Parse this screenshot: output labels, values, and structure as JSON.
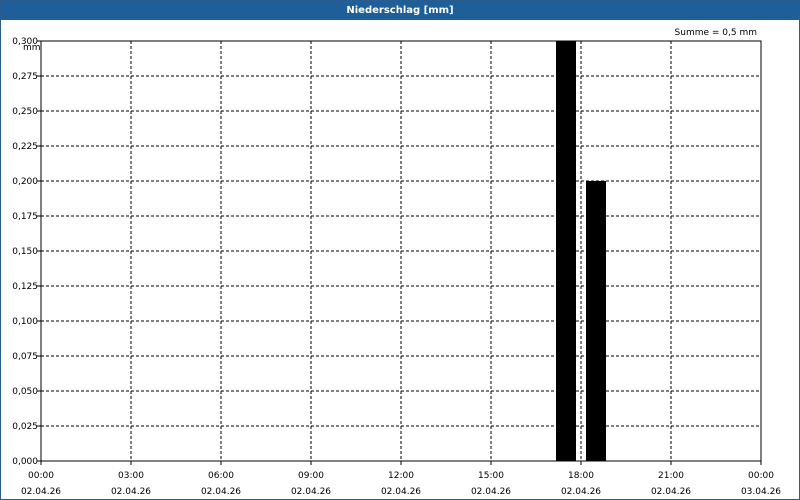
{
  "window": {
    "title": "Niederschlag [mm]"
  },
  "chart_data": {
    "type": "bar",
    "title": "Niederschlag [mm]",
    "ylabel": "mm",
    "summary": "Summe = 0,5 mm",
    "ylim": [
      0,
      0.3
    ],
    "yticks": [
      "0,000",
      "0,025",
      "0,050",
      "0,075",
      "0,100",
      "0,125",
      "0,150",
      "0,175",
      "0,200",
      "0,225",
      "0,250",
      "0,275",
      "0,300"
    ],
    "xlim_hours": [
      0,
      24
    ],
    "xticks": [
      {
        "time": "00:00",
        "date": "02.04.26"
      },
      {
        "time": "03:00",
        "date": "02.04.26"
      },
      {
        "time": "06:00",
        "date": "02.04.26"
      },
      {
        "time": "09:00",
        "date": "02.04.26"
      },
      {
        "time": "12:00",
        "date": "02.04.26"
      },
      {
        "time": "15:00",
        "date": "02.04.26"
      },
      {
        "time": "18:00",
        "date": "02.04.26"
      },
      {
        "time": "21:00",
        "date": "02.04.26"
      },
      {
        "time": "00:00",
        "date": "03.04.26"
      }
    ],
    "bars": [
      {
        "start": "02.04.26 17:10",
        "end": "02.04.26 17:50",
        "value": 0.3
      },
      {
        "start": "02.04.26 18:10",
        "end": "02.04.26 18:50",
        "value": 0.2
      }
    ],
    "grid": true,
    "bar_color": "#000000"
  }
}
